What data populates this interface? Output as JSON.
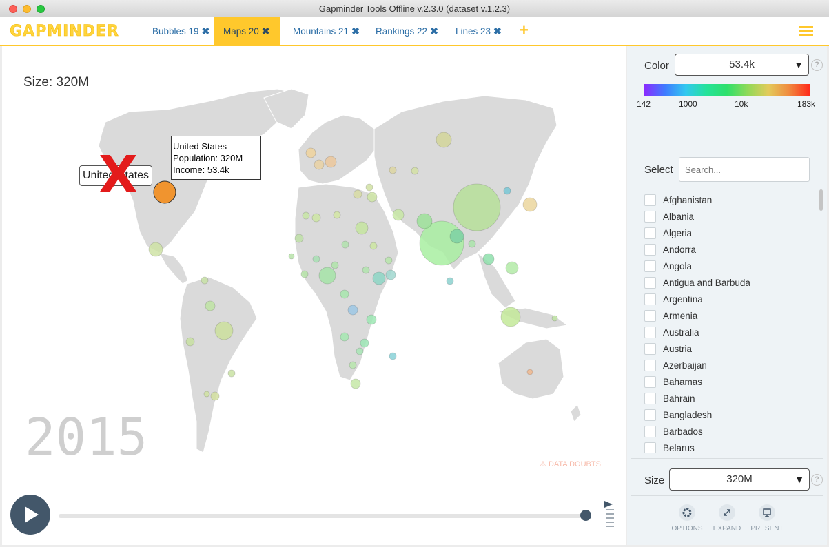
{
  "window": {
    "title": "Gapminder Tools Offline v.2.3.0 (dataset v.1.2.3)"
  },
  "header": {
    "logo": "GAPMINDER",
    "tabs": [
      {
        "label": "Bubbles 19"
      },
      {
        "label": "Maps 20"
      },
      {
        "label": "Mountains 21"
      },
      {
        "label": "Rankings 22"
      },
      {
        "label": "Lines 23"
      }
    ],
    "add_label": "+",
    "close_glyph": "✖"
  },
  "chart": {
    "size_label": "Size: 320M",
    "year": "2015",
    "data_doubts": "DATA DOUBTS",
    "tooltip": {
      "name": "United States",
      "population": "Population: 320M",
      "income": "Income: 53.4k"
    },
    "label": "United States",
    "marker": "X"
  },
  "panel": {
    "color": {
      "label": "Color",
      "selected": "53.4k",
      "ticks": [
        "142",
        "1000",
        "10k",
        "183k"
      ]
    },
    "select": {
      "label": "Select",
      "placeholder": "Search...",
      "countries": [
        "Afghanistan",
        "Albania",
        "Algeria",
        "Andorra",
        "Angola",
        "Antigua and Barbuda",
        "Argentina",
        "Armenia",
        "Australia",
        "Austria",
        "Azerbaijan",
        "Bahamas",
        "Bahrain",
        "Bangladesh",
        "Barbados",
        "Belarus"
      ]
    },
    "size": {
      "label": "Size",
      "selected": "320M"
    },
    "buttons": {
      "options": "OPTIONS",
      "expand": "EXPAND",
      "present": "PRESENT"
    },
    "help": "?"
  },
  "colors": {
    "accent": "#ffc82c",
    "link": "#2c6ea6",
    "dark": "#43576a",
    "highlight_bubble": "#f0942f"
  }
}
